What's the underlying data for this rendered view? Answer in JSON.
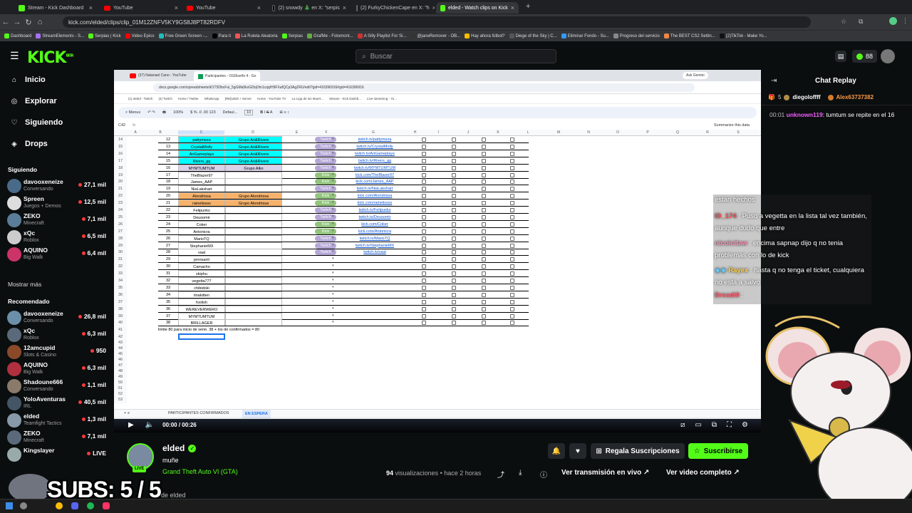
{
  "browser": {
    "tabs": [
      {
        "label": "Stream - Kick Dashboard",
        "icon": "kick-icon"
      },
      {
        "label": "YouTube",
        "icon": "youtube-icon"
      },
      {
        "label": "YouTube",
        "icon": "youtube-icon"
      },
      {
        "label": "(2) snowdy 🎄 en X: \"serpis",
        "icon": "x-icon"
      },
      {
        "label": "(2) FurkyChickenCape en X: \"h",
        "icon": "x-icon"
      },
      {
        "label": "elded - Watch clips on Kick",
        "icon": "kick-icon",
        "active": true
      }
    ],
    "url": "kick.com/elded/clips/clip_01M12ZNFV5KY9GS8J8PT82RDFV",
    "bookmarks": [
      "Dashboard",
      "StreamElements - S...",
      "Serpias | Kick",
      "Video Epico",
      "Free Green Screen -...",
      "Para ti",
      "La Ruleta Aleatoria",
      "Serpias",
      "GrafMe - Fotomont...",
      "A Silly Playlist For Si...",
      "@janeRemover - OB...",
      "Hay ahora fútbol?",
      "Diege of the Sky | C...",
      "Eliminar Fondo - Su...",
      "Progreso del servicio",
      "The BEST CS2 Settin...",
      "(2)TikTok - Make Yo..."
    ]
  },
  "header": {
    "logo": "KICK",
    "logo_badge": "BETA",
    "search_placeholder": "Buscar",
    "points": "88"
  },
  "sidebar": {
    "nav": [
      {
        "label": "Inicio",
        "icon": "home-icon"
      },
      {
        "label": "Explorar",
        "icon": "compass-icon"
      },
      {
        "label": "Siguiendo",
        "icon": "heart-icon"
      },
      {
        "label": "Drops",
        "icon": "drops-icon"
      }
    ],
    "following_title": "Siguiendo",
    "following": [
      {
        "name": "davooxeneize",
        "category": "Conversando",
        "viewers": "27,1 mil"
      },
      {
        "name": "Spreen",
        "category": "Juegos + Demos",
        "viewers": "12,5 mil"
      },
      {
        "name": "ZEKO",
        "category": "Minecraft",
        "viewers": "7,1 mil"
      },
      {
        "name": "xQc",
        "category": "Roblox",
        "viewers": "6,5 mil"
      },
      {
        "name": "AQUINO",
        "category": "Big Walk",
        "viewers": "6,4 mil"
      }
    ],
    "show_all": "Mostrar más",
    "recommended_title": "Recomendado",
    "recommended": [
      {
        "name": "davooxeneize",
        "category": "Conversando",
        "viewers": "26,8 mil"
      },
      {
        "name": "xQc",
        "category": "Roblox",
        "viewers": "6,3 mil"
      },
      {
        "name": "12amcupid",
        "category": "Slots & Casino",
        "viewers": "950"
      },
      {
        "name": "AQUINO",
        "category": "Big Walk",
        "viewers": "6,3 mil"
      },
      {
        "name": "Shadoune666",
        "category": "Conversando",
        "viewers": "1,1 mil"
      },
      {
        "name": "YoloAventuras",
        "category": "IRL",
        "viewers": "40,5 mil"
      },
      {
        "name": "elded",
        "category": "Teamfight Tactics",
        "viewers": "1,3 mil"
      },
      {
        "name": "ZEKO",
        "category": "Minecraft",
        "viewers": "7,1 mil"
      },
      {
        "name": "Kingslayer",
        "category": "",
        "viewers": "LIVE"
      }
    ]
  },
  "overlay": {
    "subs": "SUBS: 5 / 5",
    "partial": "de elded"
  },
  "video": {
    "time": "00:00 / 00:26",
    "inner_browser": {
      "tabs": [
        "(37) Natanael Cano - YouTube",
        "Participantes - OSDiseño 4 - Go"
      ],
      "url": "docs.google.com/spreadsheets/d/1T5DbcFui_5gGMa5kxGl3qOtn1cqq/H9FXafQCp3AgZRU/edit?gid=416396916#gid=416396916",
      "bookmarks": [
        "(1) elded - Twitch",
        "(4) Twitch",
        "Home / Twitter",
        "WhatsApp",
        "[RE]selidi + Server",
        "Home - YouTube TV",
        "La Liga de los Muert...",
        "Stream - Kick Dashb...",
        "Live streaming - Yo..."
      ],
      "ask_label": "Ask Gemini"
    },
    "sheet": {
      "cellref": "C42",
      "zoom": "100%",
      "font": "Defaul...",
      "fontsize": "10",
      "summarize": "Summarize this data",
      "col_headers": [
        "A",
        "B",
        "C",
        "D",
        "E",
        "F",
        "G",
        "H",
        "I",
        "J",
        "K",
        "L",
        "M",
        "N",
        "O",
        "P",
        "Q",
        "R",
        "S"
      ],
      "rows": [
        {
          "n": "14",
          "num": "12",
          "name": "pattymeza",
          "group": "Grupo Ari&Rivers",
          "platform": "Twitch",
          "link": "twitch.tv/pattymeza",
          "color": "cyan"
        },
        {
          "n": "15",
          "num": "13",
          "name": "CrystalMolly",
          "group": "Grupo Ari&Rivers",
          "platform": "Twitch",
          "link": "twitch.tv/CrystalMolly",
          "color": "cyan"
        },
        {
          "n": "16",
          "num": "14",
          "name": "AriGameplays",
          "group": "Grupo Ari&Rivers",
          "platform": "Twitch",
          "link": "twitch.tv/AriGameplays",
          "color": "cyan"
        },
        {
          "n": "17",
          "num": "15",
          "name": "Rivers_gg",
          "group": "Grupo Ari&Rivers",
          "platform": "Twitch",
          "link": "twitch.tv/Rivers_gg",
          "color": "cyan"
        },
        {
          "n": "18",
          "num": "16",
          "name": "MYMTUMTUM",
          "group": "Grupo Alko",
          "platform": "Twitch",
          "link": "twitch.tv/MYMTUMTUM",
          "color": "lav"
        },
        {
          "n": "19",
          "num": "17",
          "name": "TheBlazer97",
          "group": "",
          "platform": "Kick",
          "link": "kick.com/TheBlazer97",
          "color": ""
        },
        {
          "n": "20",
          "num": "18",
          "name": "James_AAP",
          "group": "",
          "platform": "Kick",
          "link": "kick.com/James_AAP",
          "color": ""
        },
        {
          "n": "21",
          "num": "19",
          "name": "NiaLakshart",
          "group": "",
          "platform": "Twitch",
          "link": "twitch.tv/NiaLakshart",
          "color": ""
        },
        {
          "n": "22",
          "num": "20",
          "name": "Alondrissa",
          "group": "Grupo Alondrissa",
          "platform": "Kick",
          "link": "kick.com/Alondrissa",
          "color": "orange"
        },
        {
          "n": "23",
          "num": "21",
          "name": "rainelissss",
          "group": "Grupo Alondrissa",
          "platform": "Kick",
          "link": "kick.com/rainelissss",
          "color": "orange"
        },
        {
          "n": "24",
          "num": "22",
          "name": "Felipunks",
          "group": "",
          "platform": "Twitch",
          "link": "twitch.tv/Felipunks",
          "color": ""
        },
        {
          "n": "25",
          "num": "23",
          "name": "Deusomir",
          "group": "",
          "platform": "Twitch",
          "link": "twitch.tv/Deusomir",
          "color": ""
        },
        {
          "n": "26",
          "num": "24",
          "name": "Coker",
          "group": "",
          "platform": "Kick",
          "link": "kick.com/Coker",
          "color": ""
        },
        {
          "n": "27",
          "num": "25",
          "name": "Antonicra",
          "group": "",
          "platform": "Kick",
          "link": "kick.com/Antonicra",
          "color": ""
        },
        {
          "n": "28",
          "num": "26",
          "name": "MarioTQ",
          "group": "",
          "platform": "Twitch",
          "link": "twitch.tv/MarioTQ",
          "color": ""
        },
        {
          "n": "29",
          "num": "27",
          "name": "StephanieMX",
          "group": "",
          "platform": "Twitch",
          "link": "twitch.tv/StephanieMX",
          "color": ""
        },
        {
          "n": "30",
          "num": "28",
          "name": "vaal",
          "group": "",
          "platform": "Twitch",
          "link": "twitch.tv/vaal",
          "color": ""
        },
        {
          "n": "31",
          "num": "29",
          "name": "jennsanli",
          "group": "",
          "platform": "",
          "link": "",
          "color": ""
        },
        {
          "n": "32",
          "num": "30",
          "name": "Camacho",
          "group": "",
          "platform": "",
          "link": "",
          "color": ""
        },
        {
          "n": "33",
          "num": "31",
          "name": "xkiphu",
          "group": "",
          "platform": "",
          "link": "",
          "color": ""
        },
        {
          "n": "34",
          "num": "32",
          "name": "vegetta777",
          "group": "",
          "platform": "",
          "link": "",
          "color": ""
        },
        {
          "n": "35",
          "num": "33",
          "name": "chibidoki",
          "group": "",
          "platform": "",
          "link": "",
          "color": ""
        },
        {
          "n": "36",
          "num": "34",
          "name": "tinakitten",
          "group": "",
          "platform": "",
          "link": "",
          "color": ""
        },
        {
          "n": "37",
          "num": "35",
          "name": "foolish",
          "group": "",
          "platform": "",
          "link": "",
          "color": ""
        },
        {
          "n": "38",
          "num": "36",
          "name": "WEREVERWERO",
          "group": "",
          "platform": "",
          "link": "",
          "color": ""
        },
        {
          "n": "39",
          "num": "37",
          "name": "MYMTUMTUM",
          "group": "",
          "platform": "",
          "link": "",
          "color": ""
        },
        {
          "n": "40",
          "num": "38",
          "name": "BRILLAGER",
          "group": "",
          "platform": "",
          "link": "",
          "color": ""
        }
      ],
      "note_row": "41",
      "note": "limite 80 para inicio de serie. 38 + los de confirmados = 80",
      "empty_rows": [
        "42",
        "43",
        "44",
        "45",
        "46",
        "47",
        "48",
        "49",
        "50",
        "51",
        "52",
        "53"
      ],
      "sheet_tabs": [
        "PARTICIPANTES CONFIRMADOS",
        "EN ESPERA"
      ],
      "active_sheet": "EN ESPERA"
    }
  },
  "channel": {
    "name": "elded",
    "title": "muñe",
    "category": "Grand Theft Auto VI (GTA)",
    "live_badge": "LIVE",
    "views": "94",
    "views_label": "visualizaciones",
    "ago": "hace 2 horas",
    "gift_button": "Regala Suscripciones",
    "subscribe_button": "Suscribirse",
    "watch_live": "Ver transmisión en vivo",
    "watch_full": "Ver video completo"
  },
  "chat": {
    "title": "Chat Replay",
    "gift_count": "5",
    "gifter": "diegoloffff",
    "gifter2": "Alex63737382",
    "gift_count2": "1",
    "message_time": "00:01",
    "message_user": "unknown119",
    "message_text": "tumtum se repite en el 16"
  },
  "stream_chat": {
    "messages": [
      {
        "user": "",
        "text": "estan hechos"
      },
      {
        "user": "ID_174",
        "text": "Puso a vegetta en la lista tal vez también, aunque dudo que entre"
      },
      {
        "user": "nicolcitaw",
        "text": "encima sapnap dijo q no tenia problemas con lo de kick"
      },
      {
        "user": "Rayex",
        "text": "hasta q no tenga el ticket, cualquiera no está a salvo"
      },
      {
        "user": "Dresdi0",
        "text": ""
      }
    ]
  },
  "colors": {
    "kick_green": "#53fc18",
    "cyan": "#00ffff",
    "orange": "#f6b26b",
    "lavender": "#d9d2e9",
    "twitch_purple": "#b4a7d6",
    "kick_chip": "#93c47d"
  }
}
